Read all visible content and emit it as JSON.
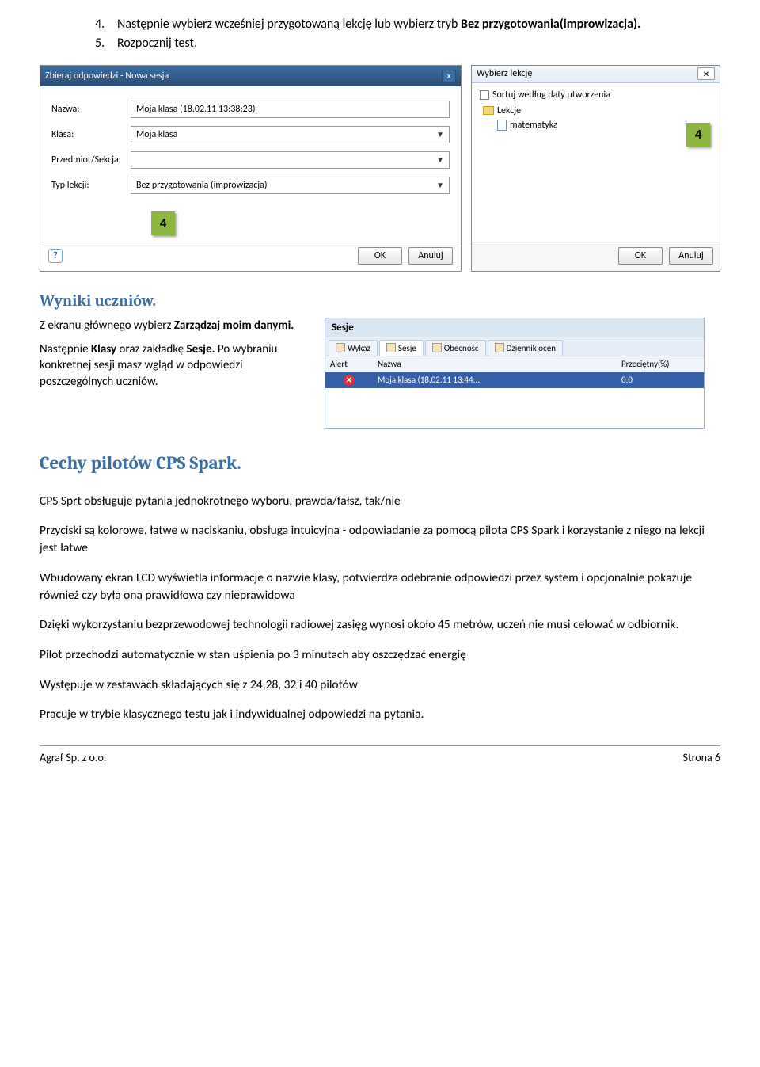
{
  "list": {
    "item4_num": "4.",
    "item4_a": "Następnie wybierz wcześniej przygotowaną lekcję lub wybierz tryb ",
    "item4_bold": "Bez przygotowania(improwizacja).",
    "item5_num": "5.",
    "item5_text": "Rozpocznij test."
  },
  "dlg1": {
    "title": "Zbieraj odpowiedzi - Nowa sesja",
    "close": "x",
    "rows": {
      "nazwa_label": "Nazwa:",
      "nazwa_value": "Moja klasa (18.02.11 13:38:23)",
      "klasa_label": "Klasa:",
      "klasa_value": "Moja klasa",
      "przedmiot_label": "Przedmiot/Sekcja:",
      "przedmiot_value": "",
      "typ_label": "Typ lekcji:",
      "typ_value": "Bez przygotowania (improwizacja)"
    },
    "help": "?",
    "ok": "OK",
    "anuluj": "Anuluj",
    "callout": "4"
  },
  "dlg2": {
    "title": "Wybierz lekcję",
    "close": "✕",
    "sort": "Sortuj według daty utworzenia",
    "folder": "Lekcje",
    "item": "matematyka",
    "ok": "OK",
    "anuluj": "Anuluj",
    "callout": "4"
  },
  "h_wyniki": "Wyniki uczniów.",
  "sec2": {
    "p1a": "Z ekranu głównego wybierz ",
    "p1b": "Zarządzaj moim danymi.",
    "p2a": "Następnie ",
    "p2b": "Klasy",
    "p2c": " oraz zakładkę ",
    "p2d": "Sesje.",
    "p2e": " Po wybraniu konkretnej sesji masz wgląd w odpowiedzi poszczególnych uczniów."
  },
  "sesje": {
    "title": "Sesje",
    "tabs": {
      "t1": "Wykaz",
      "t2": "Sesje",
      "t3": "Obecność",
      "t4": "Dziennik ocen"
    },
    "cols": {
      "c1": "Alert",
      "c2": "Nazwa",
      "c3": "Przeciętny(%)"
    },
    "row": {
      "c2": "Moja klasa (18.02.11 13:44:...",
      "c3": "0.0"
    }
  },
  "h_cechy": "Cechy pilotów CPS Spark.",
  "paras": {
    "p1": "CPS Sprt obsługuje pytania jednokrotnego wyboru, prawda/fałsz, tak/nie",
    "p2": "Przyciski są kolorowe,  łatwe w naciskaniu, obsługa intuicyjna - odpowiadanie za pomocą  pilota CPS Spark  i korzystanie z niego na lekcji jest łatwe",
    "p3": "Wbudowany ekran LCD wyświetla informacje o nazwie klasy, potwierdza odebranie odpowiedzi przez system i opcjonalnie pokazuje również czy była ona prawidłowa czy nieprawidowa",
    "p4": "Dzięki wykorzystaniu bezprzewodowej technologii radiowej zasięg wynosi około 45 metrów, uczeń nie musi celować w odbiornik.",
    "p5": "Pilot przechodzi automatycznie w stan uśpienia po 3 minutach aby oszczędzać energię",
    "p6": "Występuje w zestawach składających się z 24,28, 32 i 40 pilotów",
    "p7": "Pracuje w trybie klasycznego testu jak i indywidualnej odpowiedzi na pytania."
  },
  "footer": {
    "left": "Agraf Sp. z o.o.",
    "right": "Strona 6"
  }
}
